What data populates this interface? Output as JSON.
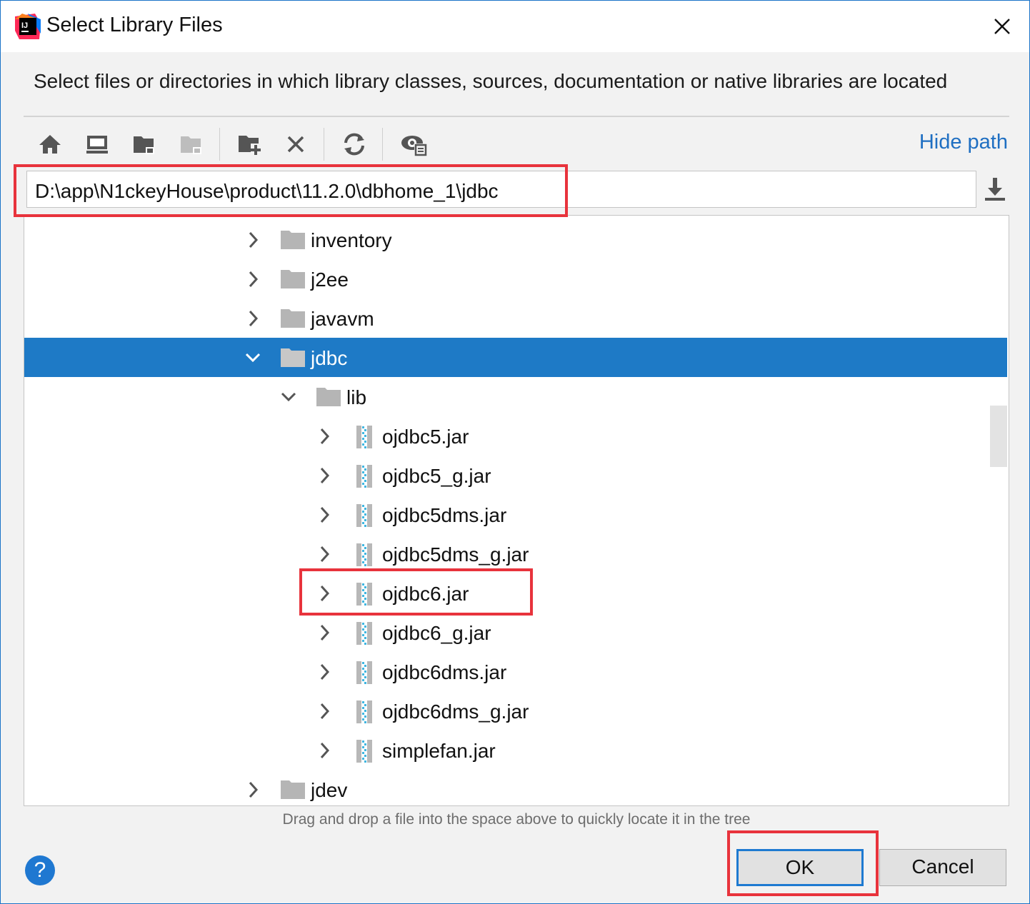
{
  "dialog": {
    "title": "Select Library Files",
    "description": "Select files or directories in which library classes, sources, documentation or native libraries are located"
  },
  "toolbar": {
    "buttons": [
      {
        "name": "home-icon"
      },
      {
        "name": "desktop-icon"
      },
      {
        "name": "project-folder-icon"
      },
      {
        "name": "module-folder-icon"
      },
      {
        "name": "new-folder-icon"
      },
      {
        "name": "delete-icon"
      },
      {
        "name": "refresh-icon"
      },
      {
        "name": "show-hidden-icon"
      }
    ],
    "hide_path_label": "Hide path"
  },
  "path": {
    "value": "D:\\app\\N1ckeyHouse\\product\\11.2.0\\dbhome_1\\jdbc"
  },
  "tree": {
    "items": [
      {
        "label": "inventory",
        "kind": "folder",
        "level": 0,
        "expanded": false,
        "selected": false
      },
      {
        "label": "j2ee",
        "kind": "folder",
        "level": 0,
        "expanded": false,
        "selected": false
      },
      {
        "label": "javavm",
        "kind": "folder",
        "level": 0,
        "expanded": false,
        "selected": false
      },
      {
        "label": "jdbc",
        "kind": "folder",
        "level": 0,
        "expanded": true,
        "selected": true
      },
      {
        "label": "lib",
        "kind": "folder",
        "level": 1,
        "expanded": true,
        "selected": false
      },
      {
        "label": "ojdbc5.jar",
        "kind": "jar",
        "level": 2,
        "expanded": false,
        "selected": false
      },
      {
        "label": "ojdbc5_g.jar",
        "kind": "jar",
        "level": 2,
        "expanded": false,
        "selected": false
      },
      {
        "label": "ojdbc5dms.jar",
        "kind": "jar",
        "level": 2,
        "expanded": false,
        "selected": false
      },
      {
        "label": "ojdbc5dms_g.jar",
        "kind": "jar",
        "level": 2,
        "expanded": false,
        "selected": false
      },
      {
        "label": "ojdbc6.jar",
        "kind": "jar",
        "level": 2,
        "expanded": false,
        "selected": false
      },
      {
        "label": "ojdbc6_g.jar",
        "kind": "jar",
        "level": 2,
        "expanded": false,
        "selected": false
      },
      {
        "label": "ojdbc6dms.jar",
        "kind": "jar",
        "level": 2,
        "expanded": false,
        "selected": false
      },
      {
        "label": "ojdbc6dms_g.jar",
        "kind": "jar",
        "level": 2,
        "expanded": false,
        "selected": false
      },
      {
        "label": "simplefan.jar",
        "kind": "jar",
        "level": 2,
        "expanded": false,
        "selected": false
      },
      {
        "label": "jdev",
        "kind": "folder",
        "level": 0,
        "expanded": false,
        "selected": false
      }
    ]
  },
  "hint": "Drag and drop a file into the space above to quickly locate it in the tree",
  "buttons": {
    "help": "?",
    "ok": "OK",
    "cancel": "Cancel"
  },
  "colors": {
    "selection": "#1e7ac6",
    "accent": "#1f6fc2",
    "annotation": "#e8333c"
  }
}
